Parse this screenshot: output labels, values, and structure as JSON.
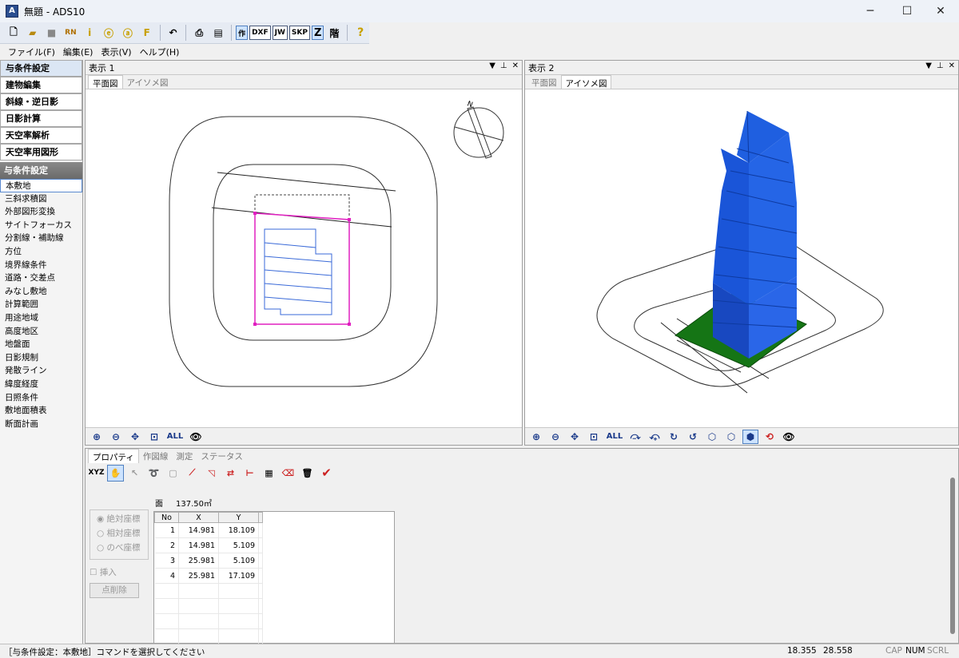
{
  "window": {
    "title": "無題 - ADS10",
    "icon_label": "A"
  },
  "toolbar": {
    "buttons": [
      "new-icon",
      "open-icon",
      "save-icon",
      "rn-icon",
      "info-icon",
      "e-icon",
      "a-icon",
      "f-icon",
      "undo-icon",
      "print-icon",
      "preview-icon"
    ],
    "mode_labels": [
      "作",
      "DXF",
      "JW",
      "SKP",
      "Z",
      "階",
      "?"
    ]
  },
  "menu": [
    "ファイル(F)",
    "編集(E)",
    "表示(V)",
    "ヘルプ(H)"
  ],
  "left": {
    "sections": [
      "与条件設定",
      "建物編集",
      "斜線・逆日影",
      "日影計算",
      "天空率解析",
      "天空率用図形"
    ],
    "header": "与条件設定",
    "items": [
      "本敷地",
      "三斜求積図",
      "外部図形変換",
      "サイトフォーカス",
      "分割線・補助線",
      "方位",
      "境界線条件",
      "道路・交差点",
      "みなし敷地",
      "計算範囲",
      "用途地域",
      "高度地区",
      "地盤面",
      "日影規制",
      "発散ライン",
      "緯度経度",
      "日照条件",
      "敷地面積表",
      "断面計画"
    ]
  },
  "view1": {
    "title": "表示 1",
    "tabs": [
      "平面図",
      "アイソメ図"
    ],
    "tools": [
      "⊕",
      "⊖",
      "✥",
      "⊡",
      "ALL",
      "👁"
    ]
  },
  "view2": {
    "title": "表示 2",
    "tabs": [
      "平面図",
      "アイソメ図"
    ],
    "tools": [
      "⊕",
      "⊖",
      "✥",
      "⊡",
      "ALL",
      "⤼",
      "⤽",
      "↻",
      "↺",
      "⬡",
      "⬡",
      "⬢",
      "⟲",
      "👁"
    ]
  },
  "view_ctl": [
    "▼",
    "⊥",
    "✕"
  ],
  "bottom": {
    "tabs": [
      "プロパティ",
      "作図線",
      "測定",
      "ステータス"
    ],
    "area_label": "面",
    "area_value": "137.50㎡",
    "radios": [
      "絶対座標",
      "相対座標",
      "のべ座標"
    ],
    "insert_label": "挿入",
    "delete_button": "点削除",
    "table": {
      "headers": [
        "No",
        "X",
        "Y"
      ],
      "rows": [
        [
          "1",
          "14.981",
          "18.109"
        ],
        [
          "2",
          "14.981",
          "5.109"
        ],
        [
          "3",
          "25.981",
          "5.109"
        ],
        [
          "4",
          "25.981",
          "17.109"
        ]
      ]
    }
  },
  "status": {
    "message": "［与条件設定：本敷地］コマンドを選択してください",
    "x": "18.355",
    "y": "28.558",
    "cap": "CAP",
    "num": "NUM",
    "scrl": "SCRL"
  },
  "colors": {
    "site": "#e020c0",
    "building": "#1a55d8",
    "ground": "#157515"
  }
}
